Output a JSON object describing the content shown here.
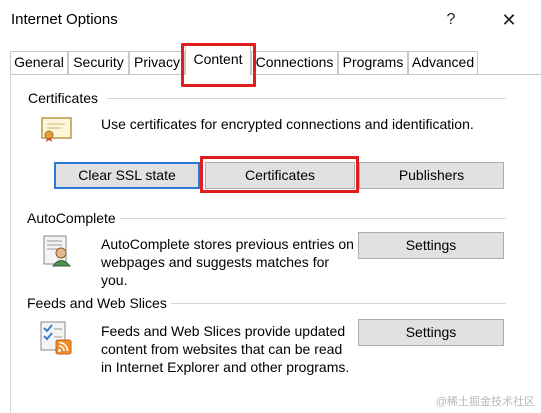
{
  "window": {
    "title": "Internet Options",
    "help_glyph": "?",
    "close_glyph": "✕"
  },
  "tabs": [
    {
      "label": "General"
    },
    {
      "label": "Security"
    },
    {
      "label": "Privacy"
    },
    {
      "label": "Content",
      "active": true
    },
    {
      "label": "Connections"
    },
    {
      "label": "Programs"
    },
    {
      "label": "Advanced"
    }
  ],
  "certificates": {
    "group_label": "Certificates",
    "description": "Use certificates for encrypted connections and identification.",
    "buttons": {
      "clear_ssl": "Clear SSL state",
      "certificates": "Certificates",
      "publishers": "Publishers"
    }
  },
  "autocomplete": {
    "group_label": "AutoComplete",
    "description_lines": [
      "AutoComplete stores previous entries on",
      "webpages and suggests matches for",
      "you."
    ],
    "settings": "Settings"
  },
  "feeds": {
    "group_label": "Feeds and Web Slices",
    "description_lines": [
      "Feeds and Web Slices provide updated",
      "content from websites that can be read",
      "in Internet Explorer and other programs."
    ],
    "settings": "Settings"
  },
  "watermark": "@稀土掘金技术社区",
  "colors": {
    "highlight": "#e01e1e",
    "focus": "#2a78d4",
    "button_face": "#e1e1e1"
  }
}
